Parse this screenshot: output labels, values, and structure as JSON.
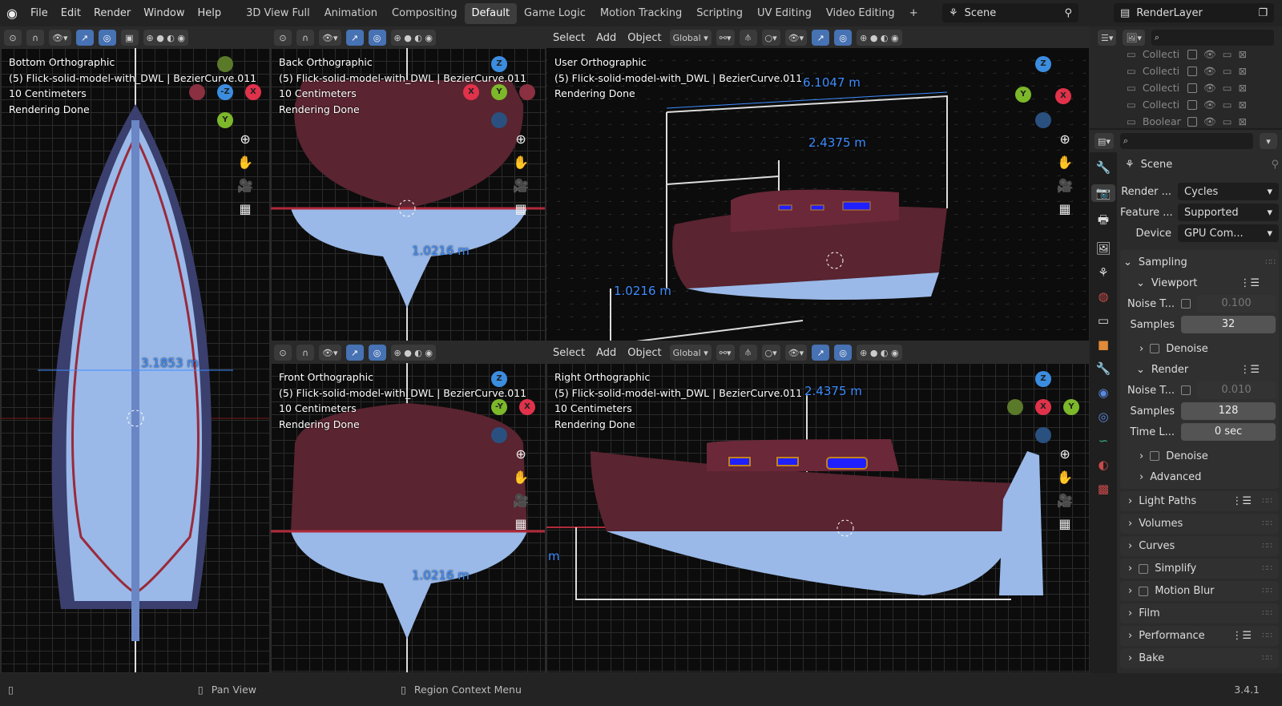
{
  "topbar": {
    "menus": [
      "File",
      "Edit",
      "Render",
      "Window",
      "Help"
    ],
    "workspaces": [
      "3D View Full",
      "Animation",
      "Compositing",
      "Default",
      "Game Logic",
      "Motion Tracking",
      "Scripting",
      "UV Editing",
      "Video Editing"
    ],
    "active_workspace": "Default",
    "add_tab": "+",
    "scene": "Scene",
    "view_layer": "RenderLayer"
  },
  "viewports": [
    {
      "view": "Bottom Orthographic",
      "object": "(5) Flick-solid-model-with_DWL | BezierCurve.011",
      "scale": "10 Centimeters",
      "status": "Rendering Done",
      "dims": [
        "3.1853 m"
      ],
      "gizmo": [
        "-Z",
        "X",
        "Y"
      ]
    },
    {
      "view": "Back Orthographic",
      "object": "(5) Flick-solid-model-with_DWL | BezierCurve.011",
      "scale": "10 Centimeters",
      "status": "Rendering Done",
      "dims": [
        "1.0216 m"
      ],
      "gizmo": [
        "Z",
        "Y",
        "X"
      ]
    },
    {
      "view": "User Orthographic",
      "object": "(5) Flick-solid-model-with_DWL | BezierCurve.011",
      "status": "Rendering Done",
      "dims": [
        "6.1047 m",
        "2.4375 m",
        "1.0216 m"
      ],
      "gizmo": [
        "Z",
        "Y",
        "X"
      ],
      "menus": [
        "Select",
        "Add",
        "Object"
      ],
      "orientation": "Global"
    },
    {
      "view": "Front Orthographic",
      "object": "(5) Flick-solid-model-with_DWL | BezierCurve.011",
      "scale": "10 Centimeters",
      "status": "Rendering Done",
      "dims": [
        "1.0216 m"
      ],
      "gizmo": [
        "Z",
        "-Y",
        "X"
      ]
    },
    {
      "view": "Right Orthographic",
      "object": "(5) Flick-solid-model-with_DWL | BezierCurve.011",
      "scale": "10 Centimeters",
      "status": "Rendering Done",
      "dims": [
        "2.4375 m",
        "m"
      ],
      "gizmo": [
        "Z",
        "X",
        "Y"
      ],
      "menus": [
        "Select",
        "Add",
        "Object"
      ],
      "orientation": "Global"
    }
  ],
  "outliner": {
    "rows": [
      "Collecti",
      "Collecti",
      "Collecti",
      "Collecti",
      "Boolean"
    ]
  },
  "properties": {
    "context": "Scene",
    "render_engine": {
      "label": "Render ...",
      "value": "Cycles"
    },
    "feature_set": {
      "label": "Feature ...",
      "value": "Supported"
    },
    "device": {
      "label": "Device",
      "value": "GPU Com..."
    },
    "sampling": "Sampling",
    "viewport": "Viewport",
    "vp_noise": {
      "label": "Noise T...",
      "value": "0.100"
    },
    "vp_samples": {
      "label": "Samples",
      "value": "32"
    },
    "denoise": "Denoise",
    "render": "Render",
    "r_noise": {
      "label": "Noise T...",
      "value": "0.010"
    },
    "r_samples": {
      "label": "Samples",
      "value": "128"
    },
    "r_time": {
      "label": "Time L...",
      "value": "0 sec"
    },
    "advanced": "Advanced",
    "panels": [
      "Light Paths",
      "Volumes",
      "Curves",
      "Simplify",
      "Motion Blur",
      "Film",
      "Performance",
      "Bake"
    ]
  },
  "statusbar": {
    "pan": "Pan View",
    "context_menu": "Region Context Menu",
    "version": "3.4.1"
  }
}
